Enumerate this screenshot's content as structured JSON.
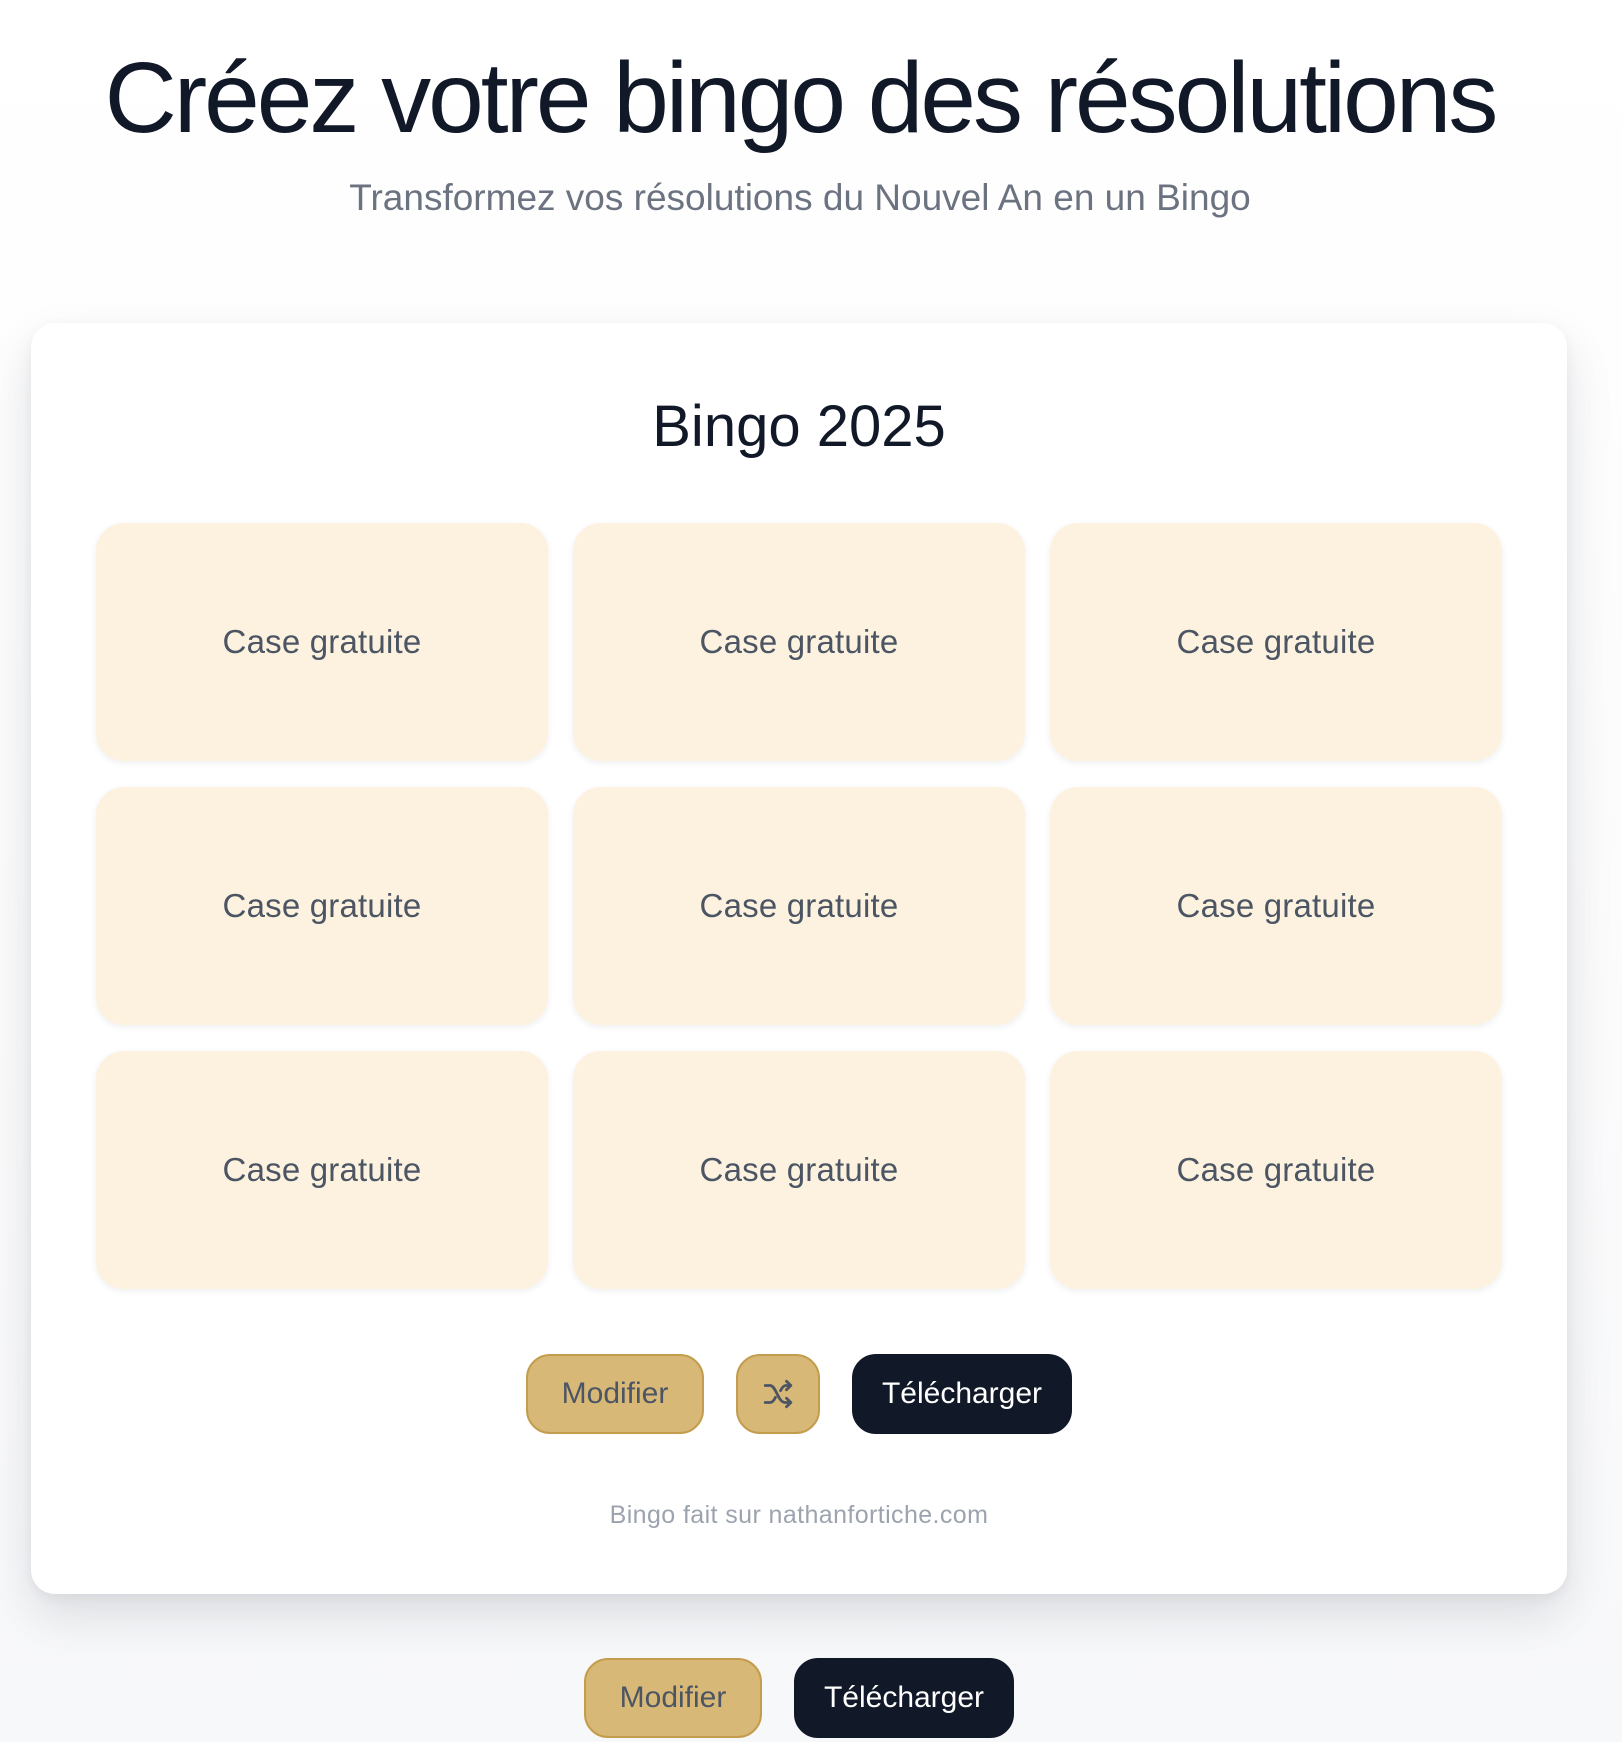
{
  "header": {
    "title": "Créez votre bingo des résolutions",
    "subtitle": "Transformez vos résolutions du Nouvel An en un Bingo"
  },
  "bingo_card": {
    "title": "Bingo 2025",
    "cells": [
      "Case gratuite",
      "Case gratuite",
      "Case gratuite",
      "Case gratuite",
      "Case gratuite",
      "Case gratuite",
      "Case gratuite",
      "Case gratuite",
      "Case gratuite"
    ],
    "actions": {
      "modify_label": "Modifier",
      "shuffle_icon": "shuffle-icon",
      "download_label": "Télécharger"
    },
    "credit": "Bingo fait sur nathanfortiche.com"
  },
  "page_actions": {
    "modify_label": "Modifier",
    "download_label": "Télécharger"
  },
  "colors": {
    "background": "#fbfbfc",
    "title_text": "#111827",
    "subtitle_text": "#6b7280",
    "card_background": "#ffffff",
    "cell_background": "#fdf2df",
    "cell_text": "#4b5563",
    "gold_button": "#d8b877",
    "gold_border": "#c39d4d",
    "dark_button": "#111827",
    "credit_text": "#9ca3af"
  }
}
